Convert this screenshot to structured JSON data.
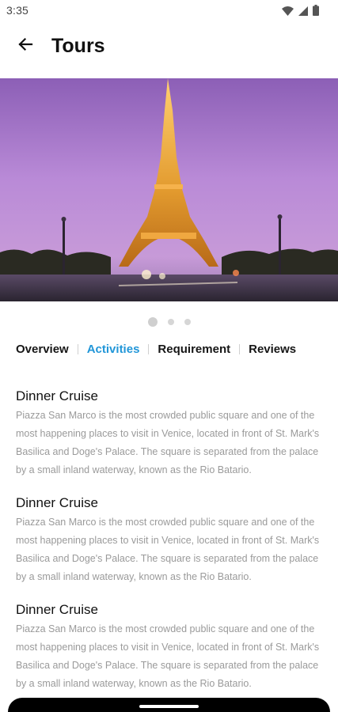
{
  "status_bar": {
    "time": "3:35",
    "icons": [
      "wifi-icon",
      "signal-icon",
      "battery-icon"
    ]
  },
  "app_bar": {
    "back_icon": "arrow-back-icon",
    "title": "Tours"
  },
  "hero": {
    "image": "eiffel-tower-at-dusk",
    "carousel_pages": 3,
    "active_page": 1
  },
  "tabs": [
    {
      "label": "Overview",
      "active": false
    },
    {
      "label": "Activities",
      "active": true
    },
    {
      "label": "Requirement",
      "active": false
    },
    {
      "label": "Reviews",
      "active": false
    }
  ],
  "activities": [
    {
      "title": "Dinner Cruise",
      "description": "Piazza San Marco is the most crowded public square and one of the most happening places to visit in Venice, located in front of St. Mark's Basilica and Doge's Palace. The square is separated from the palace by a small inland waterway, known as the Rio Batario."
    },
    {
      "title": "Dinner Cruise",
      "description": "Piazza San Marco is the most crowded public square and one of the most happening places to visit in Venice, located in front of St. Mark's Basilica and Doge's Palace. The square is separated from the palace by a small inland waterway, known as the Rio Batario."
    },
    {
      "title": "Dinner Cruise",
      "description": "Piazza San Marco is the most crowded public square and one of the most happening places to visit in Venice, located in front of St. Mark's Basilica and Doge's Palace. The square is separated from the palace by a small inland waterway, known as the Rio Batario."
    }
  ],
  "colors": {
    "accent": "#2196d8",
    "text_primary": "#111111",
    "text_secondary": "#9a9a9a"
  }
}
